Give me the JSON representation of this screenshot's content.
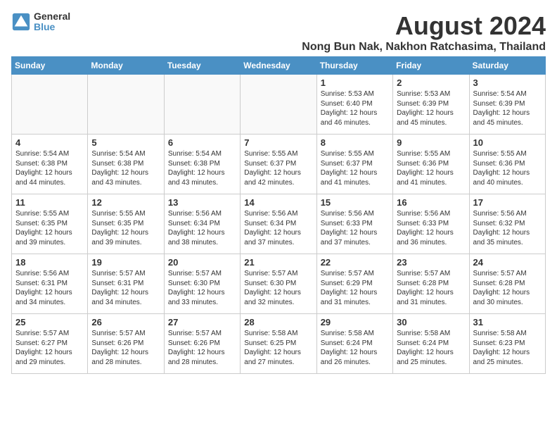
{
  "logo": {
    "general": "General",
    "blue": "Blue"
  },
  "title": "August 2024",
  "location": "Nong Bun Nak, Nakhon Ratchasima, Thailand",
  "headers": [
    "Sunday",
    "Monday",
    "Tuesday",
    "Wednesday",
    "Thursday",
    "Friday",
    "Saturday"
  ],
  "weeks": [
    [
      {
        "day": "",
        "info": "",
        "empty": true
      },
      {
        "day": "",
        "info": "",
        "empty": true
      },
      {
        "day": "",
        "info": "",
        "empty": true
      },
      {
        "day": "",
        "info": "",
        "empty": true
      },
      {
        "day": "1",
        "info": "Sunrise: 5:53 AM\nSunset: 6:40 PM\nDaylight: 12 hours\nand 46 minutes."
      },
      {
        "day": "2",
        "info": "Sunrise: 5:53 AM\nSunset: 6:39 PM\nDaylight: 12 hours\nand 45 minutes."
      },
      {
        "day": "3",
        "info": "Sunrise: 5:54 AM\nSunset: 6:39 PM\nDaylight: 12 hours\nand 45 minutes."
      }
    ],
    [
      {
        "day": "4",
        "info": "Sunrise: 5:54 AM\nSunset: 6:38 PM\nDaylight: 12 hours\nand 44 minutes."
      },
      {
        "day": "5",
        "info": "Sunrise: 5:54 AM\nSunset: 6:38 PM\nDaylight: 12 hours\nand 43 minutes."
      },
      {
        "day": "6",
        "info": "Sunrise: 5:54 AM\nSunset: 6:38 PM\nDaylight: 12 hours\nand 43 minutes."
      },
      {
        "day": "7",
        "info": "Sunrise: 5:55 AM\nSunset: 6:37 PM\nDaylight: 12 hours\nand 42 minutes."
      },
      {
        "day": "8",
        "info": "Sunrise: 5:55 AM\nSunset: 6:37 PM\nDaylight: 12 hours\nand 41 minutes."
      },
      {
        "day": "9",
        "info": "Sunrise: 5:55 AM\nSunset: 6:36 PM\nDaylight: 12 hours\nand 41 minutes."
      },
      {
        "day": "10",
        "info": "Sunrise: 5:55 AM\nSunset: 6:36 PM\nDaylight: 12 hours\nand 40 minutes."
      }
    ],
    [
      {
        "day": "11",
        "info": "Sunrise: 5:55 AM\nSunset: 6:35 PM\nDaylight: 12 hours\nand 39 minutes."
      },
      {
        "day": "12",
        "info": "Sunrise: 5:55 AM\nSunset: 6:35 PM\nDaylight: 12 hours\nand 39 minutes."
      },
      {
        "day": "13",
        "info": "Sunrise: 5:56 AM\nSunset: 6:34 PM\nDaylight: 12 hours\nand 38 minutes."
      },
      {
        "day": "14",
        "info": "Sunrise: 5:56 AM\nSunset: 6:34 PM\nDaylight: 12 hours\nand 37 minutes."
      },
      {
        "day": "15",
        "info": "Sunrise: 5:56 AM\nSunset: 6:33 PM\nDaylight: 12 hours\nand 37 minutes."
      },
      {
        "day": "16",
        "info": "Sunrise: 5:56 AM\nSunset: 6:33 PM\nDaylight: 12 hours\nand 36 minutes."
      },
      {
        "day": "17",
        "info": "Sunrise: 5:56 AM\nSunset: 6:32 PM\nDaylight: 12 hours\nand 35 minutes."
      }
    ],
    [
      {
        "day": "18",
        "info": "Sunrise: 5:56 AM\nSunset: 6:31 PM\nDaylight: 12 hours\nand 34 minutes."
      },
      {
        "day": "19",
        "info": "Sunrise: 5:57 AM\nSunset: 6:31 PM\nDaylight: 12 hours\nand 34 minutes."
      },
      {
        "day": "20",
        "info": "Sunrise: 5:57 AM\nSunset: 6:30 PM\nDaylight: 12 hours\nand 33 minutes."
      },
      {
        "day": "21",
        "info": "Sunrise: 5:57 AM\nSunset: 6:30 PM\nDaylight: 12 hours\nand 32 minutes."
      },
      {
        "day": "22",
        "info": "Sunrise: 5:57 AM\nSunset: 6:29 PM\nDaylight: 12 hours\nand 31 minutes."
      },
      {
        "day": "23",
        "info": "Sunrise: 5:57 AM\nSunset: 6:28 PM\nDaylight: 12 hours\nand 31 minutes."
      },
      {
        "day": "24",
        "info": "Sunrise: 5:57 AM\nSunset: 6:28 PM\nDaylight: 12 hours\nand 30 minutes."
      }
    ],
    [
      {
        "day": "25",
        "info": "Sunrise: 5:57 AM\nSunset: 6:27 PM\nDaylight: 12 hours\nand 29 minutes."
      },
      {
        "day": "26",
        "info": "Sunrise: 5:57 AM\nSunset: 6:26 PM\nDaylight: 12 hours\nand 28 minutes."
      },
      {
        "day": "27",
        "info": "Sunrise: 5:57 AM\nSunset: 6:26 PM\nDaylight: 12 hours\nand 28 minutes."
      },
      {
        "day": "28",
        "info": "Sunrise: 5:58 AM\nSunset: 6:25 PM\nDaylight: 12 hours\nand 27 minutes."
      },
      {
        "day": "29",
        "info": "Sunrise: 5:58 AM\nSunset: 6:24 PM\nDaylight: 12 hours\nand 26 minutes."
      },
      {
        "day": "30",
        "info": "Sunrise: 5:58 AM\nSunset: 6:24 PM\nDaylight: 12 hours\nand 25 minutes."
      },
      {
        "day": "31",
        "info": "Sunrise: 5:58 AM\nSunset: 6:23 PM\nDaylight: 12 hours\nand 25 minutes."
      }
    ]
  ]
}
